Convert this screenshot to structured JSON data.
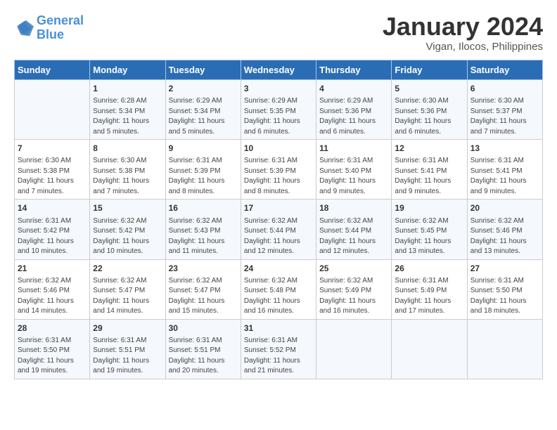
{
  "logo": {
    "line1": "General",
    "line2": "Blue"
  },
  "title": "January 2024",
  "subtitle": "Vigan, Ilocos, Philippines",
  "days_of_week": [
    "Sunday",
    "Monday",
    "Tuesday",
    "Wednesday",
    "Thursday",
    "Friday",
    "Saturday"
  ],
  "weeks": [
    [
      {
        "day": "",
        "sunrise": "",
        "sunset": "",
        "daylight": ""
      },
      {
        "day": "1",
        "sunrise": "Sunrise: 6:28 AM",
        "sunset": "Sunset: 5:34 PM",
        "daylight": "Daylight: 11 hours and 5 minutes."
      },
      {
        "day": "2",
        "sunrise": "Sunrise: 6:29 AM",
        "sunset": "Sunset: 5:34 PM",
        "daylight": "Daylight: 11 hours and 5 minutes."
      },
      {
        "day": "3",
        "sunrise": "Sunrise: 6:29 AM",
        "sunset": "Sunset: 5:35 PM",
        "daylight": "Daylight: 11 hours and 6 minutes."
      },
      {
        "day": "4",
        "sunrise": "Sunrise: 6:29 AM",
        "sunset": "Sunset: 5:36 PM",
        "daylight": "Daylight: 11 hours and 6 minutes."
      },
      {
        "day": "5",
        "sunrise": "Sunrise: 6:30 AM",
        "sunset": "Sunset: 5:36 PM",
        "daylight": "Daylight: 11 hours and 6 minutes."
      },
      {
        "day": "6",
        "sunrise": "Sunrise: 6:30 AM",
        "sunset": "Sunset: 5:37 PM",
        "daylight": "Daylight: 11 hours and 7 minutes."
      }
    ],
    [
      {
        "day": "7",
        "sunrise": "Sunrise: 6:30 AM",
        "sunset": "Sunset: 5:38 PM",
        "daylight": "Daylight: 11 hours and 7 minutes."
      },
      {
        "day": "8",
        "sunrise": "Sunrise: 6:30 AM",
        "sunset": "Sunset: 5:38 PM",
        "daylight": "Daylight: 11 hours and 7 minutes."
      },
      {
        "day": "9",
        "sunrise": "Sunrise: 6:31 AM",
        "sunset": "Sunset: 5:39 PM",
        "daylight": "Daylight: 11 hours and 8 minutes."
      },
      {
        "day": "10",
        "sunrise": "Sunrise: 6:31 AM",
        "sunset": "Sunset: 5:39 PM",
        "daylight": "Daylight: 11 hours and 8 minutes."
      },
      {
        "day": "11",
        "sunrise": "Sunrise: 6:31 AM",
        "sunset": "Sunset: 5:40 PM",
        "daylight": "Daylight: 11 hours and 9 minutes."
      },
      {
        "day": "12",
        "sunrise": "Sunrise: 6:31 AM",
        "sunset": "Sunset: 5:41 PM",
        "daylight": "Daylight: 11 hours and 9 minutes."
      },
      {
        "day": "13",
        "sunrise": "Sunrise: 6:31 AM",
        "sunset": "Sunset: 5:41 PM",
        "daylight": "Daylight: 11 hours and 9 minutes."
      }
    ],
    [
      {
        "day": "14",
        "sunrise": "Sunrise: 6:31 AM",
        "sunset": "Sunset: 5:42 PM",
        "daylight": "Daylight: 11 hours and 10 minutes."
      },
      {
        "day": "15",
        "sunrise": "Sunrise: 6:32 AM",
        "sunset": "Sunset: 5:42 PM",
        "daylight": "Daylight: 11 hours and 10 minutes."
      },
      {
        "day": "16",
        "sunrise": "Sunrise: 6:32 AM",
        "sunset": "Sunset: 5:43 PM",
        "daylight": "Daylight: 11 hours and 11 minutes."
      },
      {
        "day": "17",
        "sunrise": "Sunrise: 6:32 AM",
        "sunset": "Sunset: 5:44 PM",
        "daylight": "Daylight: 11 hours and 12 minutes."
      },
      {
        "day": "18",
        "sunrise": "Sunrise: 6:32 AM",
        "sunset": "Sunset: 5:44 PM",
        "daylight": "Daylight: 11 hours and 12 minutes."
      },
      {
        "day": "19",
        "sunrise": "Sunrise: 6:32 AM",
        "sunset": "Sunset: 5:45 PM",
        "daylight": "Daylight: 11 hours and 13 minutes."
      },
      {
        "day": "20",
        "sunrise": "Sunrise: 6:32 AM",
        "sunset": "Sunset: 5:46 PM",
        "daylight": "Daylight: 11 hours and 13 minutes."
      }
    ],
    [
      {
        "day": "21",
        "sunrise": "Sunrise: 6:32 AM",
        "sunset": "Sunset: 5:46 PM",
        "daylight": "Daylight: 11 hours and 14 minutes."
      },
      {
        "day": "22",
        "sunrise": "Sunrise: 6:32 AM",
        "sunset": "Sunset: 5:47 PM",
        "daylight": "Daylight: 11 hours and 14 minutes."
      },
      {
        "day": "23",
        "sunrise": "Sunrise: 6:32 AM",
        "sunset": "Sunset: 5:47 PM",
        "daylight": "Daylight: 11 hours and 15 minutes."
      },
      {
        "day": "24",
        "sunrise": "Sunrise: 6:32 AM",
        "sunset": "Sunset: 5:48 PM",
        "daylight": "Daylight: 11 hours and 16 minutes."
      },
      {
        "day": "25",
        "sunrise": "Sunrise: 6:32 AM",
        "sunset": "Sunset: 5:49 PM",
        "daylight": "Daylight: 11 hours and 16 minutes."
      },
      {
        "day": "26",
        "sunrise": "Sunrise: 6:31 AM",
        "sunset": "Sunset: 5:49 PM",
        "daylight": "Daylight: 11 hours and 17 minutes."
      },
      {
        "day": "27",
        "sunrise": "Sunrise: 6:31 AM",
        "sunset": "Sunset: 5:50 PM",
        "daylight": "Daylight: 11 hours and 18 minutes."
      }
    ],
    [
      {
        "day": "28",
        "sunrise": "Sunrise: 6:31 AM",
        "sunset": "Sunset: 5:50 PM",
        "daylight": "Daylight: 11 hours and 19 minutes."
      },
      {
        "day": "29",
        "sunrise": "Sunrise: 6:31 AM",
        "sunset": "Sunset: 5:51 PM",
        "daylight": "Daylight: 11 hours and 19 minutes."
      },
      {
        "day": "30",
        "sunrise": "Sunrise: 6:31 AM",
        "sunset": "Sunset: 5:51 PM",
        "daylight": "Daylight: 11 hours and 20 minutes."
      },
      {
        "day": "31",
        "sunrise": "Sunrise: 6:31 AM",
        "sunset": "Sunset: 5:52 PM",
        "daylight": "Daylight: 11 hours and 21 minutes."
      },
      {
        "day": "",
        "sunrise": "",
        "sunset": "",
        "daylight": ""
      },
      {
        "day": "",
        "sunrise": "",
        "sunset": "",
        "daylight": ""
      },
      {
        "day": "",
        "sunrise": "",
        "sunset": "",
        "daylight": ""
      }
    ]
  ]
}
